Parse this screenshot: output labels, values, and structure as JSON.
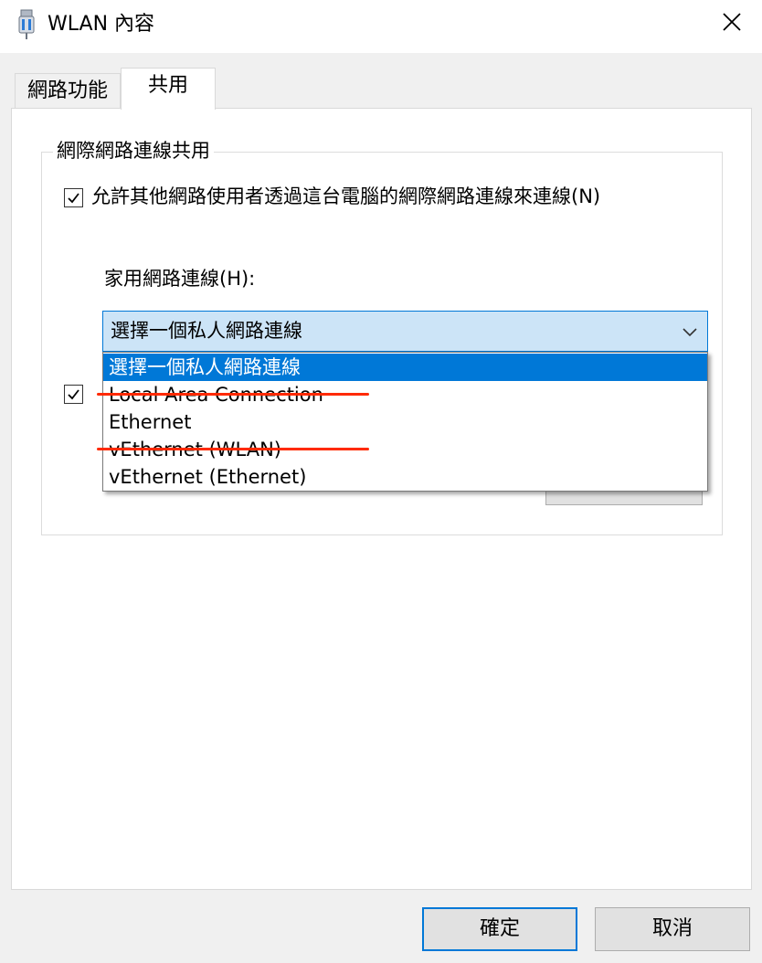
{
  "window": {
    "title": "WLAN 內容",
    "icon": "network-adapter-icon",
    "close_icon": "close-icon"
  },
  "tabs": [
    {
      "label": "網路功能",
      "active": false
    },
    {
      "label": "共用",
      "active": true
    }
  ],
  "sharing": {
    "group_title": "網際網路連線共用",
    "allow_sharing": {
      "label": "允許其他網路使用者透過這台電腦的網際網路連線來連線(N)",
      "checked": true
    },
    "home_network_label": "家用網路連線(H):",
    "home_network_select": {
      "value": "選擇一個私人網路連線"
    },
    "second_checkbox": {
      "checked": true
    },
    "dropdown_options": [
      {
        "label": "選擇一個私人網路連線",
        "selected": true,
        "crossed_out": false
      },
      {
        "label": "Local Area Connection",
        "selected": false,
        "crossed_out": true
      },
      {
        "label": "Ethernet",
        "selected": false,
        "crossed_out": false
      },
      {
        "label": "vEthernet (WLAN)",
        "selected": false,
        "crossed_out": true
      },
      {
        "label": "vEthernet (Ethernet)",
        "selected": false,
        "crossed_out": false
      }
    ]
  },
  "footer": {
    "ok_label": "確定",
    "cancel_label": "取消"
  },
  "colors": {
    "accent": "#0078d7",
    "combo_background": "#cce4f7",
    "annotation_strike": "#ff2a00"
  }
}
